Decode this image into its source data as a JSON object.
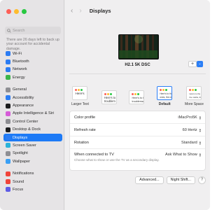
{
  "window": {
    "title": "Displays"
  },
  "sidebar": {
    "search_placeholder": "Search",
    "backup_note": "There are 26 days left to back up your account for accidental damage.",
    "groups": [
      [
        {
          "label": "Wi-Fi",
          "icon": "wifi-icon",
          "color": "#2b7cf3"
        },
        {
          "label": "Bluetooth",
          "icon": "bluetooth-icon",
          "color": "#2b7cf3"
        },
        {
          "label": "Network",
          "icon": "network-icon",
          "color": "#2b7cf3"
        },
        {
          "label": "Energy",
          "icon": "energy-icon",
          "color": "#3bb54a"
        }
      ],
      [
        {
          "label": "General",
          "icon": "gear-icon",
          "color": "#8e8e93"
        },
        {
          "label": "Accessibility",
          "icon": "accessibility-icon",
          "color": "#2b7cf3"
        },
        {
          "label": "Appearance",
          "icon": "appearance-icon",
          "color": "#1c1c1e"
        },
        {
          "label": "Apple Intelligence & Siri",
          "icon": "siri-icon",
          "color": "#d65bd8"
        },
        {
          "label": "Control Center",
          "icon": "control-center-icon",
          "color": "#8e8e93"
        },
        {
          "label": "Desktop & Dock",
          "icon": "dock-icon",
          "color": "#1c1c1e"
        },
        {
          "label": "Displays",
          "icon": "display-icon",
          "color": "#2b7cf3",
          "active": true
        },
        {
          "label": "Screen Saver",
          "icon": "screen-saver-icon",
          "color": "#2bb3d9"
        },
        {
          "label": "Spotlight",
          "icon": "spotlight-icon",
          "color": "#8e8e93"
        },
        {
          "label": "Wallpaper",
          "icon": "wallpaper-icon",
          "color": "#3a9ff5"
        }
      ],
      [
        {
          "label": "Notifications",
          "icon": "notifications-icon",
          "color": "#f0443a"
        },
        {
          "label": "Sound",
          "icon": "sound-icon",
          "color": "#f0443a"
        },
        {
          "label": "Focus",
          "icon": "focus-icon",
          "color": "#5e5ce6"
        }
      ]
    ]
  },
  "header": {
    "back": "‹",
    "forward": "›",
    "title": "Displays"
  },
  "display": {
    "name": "H2.1 5K DSC",
    "add_symbol": "+",
    "dropdown_symbol": "⌄"
  },
  "resolution_options": [
    {
      "thumb_text": "Here's",
      "label": "Larger Text",
      "selected": false
    },
    {
      "thumb_text": "Here's to\ntroublem",
      "label": "",
      "selected": false
    },
    {
      "thumb_text": "Here's to the\ntroublemakers",
      "label": "",
      "selected": false
    },
    {
      "thumb_text": "Here's to the crazy\nones, the misfits",
      "label": "Default",
      "selected": true
    },
    {
      "thumb_text": "Here's to the crazy ones\nthe misfits, the rebels",
      "label": "More Space",
      "selected": false
    }
  ],
  "settings": {
    "color_profile": {
      "label": "Color profile",
      "value": "iMacPro5K"
    },
    "refresh_rate": {
      "label": "Refresh rate",
      "value": "60 Hertz"
    },
    "rotation": {
      "label": "Rotation",
      "value": "Standard"
    },
    "tv": {
      "label": "When connected to TV",
      "value": "Ask What to Show",
      "sub": "Choose what to show or use the TV as a secondary display."
    }
  },
  "buttons": {
    "advanced": "Advanced...",
    "night_shift": "Night Shift...",
    "help": "?"
  }
}
